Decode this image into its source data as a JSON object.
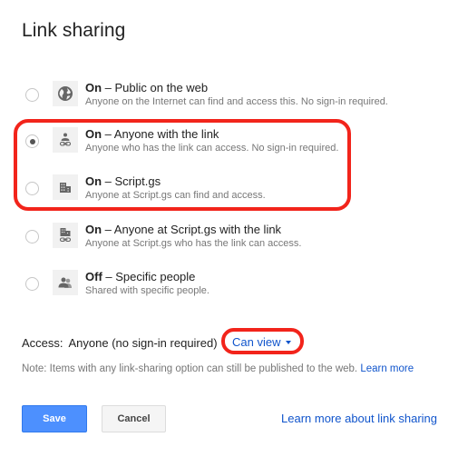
{
  "dialog": {
    "title": "Link sharing"
  },
  "options": [
    {
      "state": "On",
      "label": " – Public on the web",
      "description": "Anyone on the Internet can find and access this. No sign-in required.",
      "icon": "globe-icon",
      "selected": false
    },
    {
      "state": "On",
      "label": " – Anyone with the link",
      "description": "Anyone who has the link can access. No sign-in required.",
      "icon": "person-link-icon",
      "selected": true
    },
    {
      "state": "On",
      "label": " – Script.gs",
      "description": "Anyone at Script.gs can find and access.",
      "icon": "domain-icon",
      "selected": false
    },
    {
      "state": "On",
      "label": " – Anyone at Script.gs with the link",
      "description": "Anyone at Script.gs who has the link can access.",
      "icon": "domain-link-icon",
      "selected": false
    },
    {
      "state": "Off",
      "label": " – Specific people",
      "description": "Shared with specific people.",
      "icon": "people-icon",
      "selected": false
    }
  ],
  "access": {
    "label": "Access:",
    "value": "Anyone (no sign-in required)",
    "permission": "Can view"
  },
  "note": {
    "text": "Note: Items with any link-sharing option can still be published to the web. ",
    "link": "Learn more"
  },
  "buttons": {
    "save": "Save",
    "cancel": "Cancel"
  },
  "learn_more_sharing": "Learn more about link sharing",
  "colors": {
    "highlight": "#f2241b",
    "link": "#1155cc",
    "primary_button": "#4d90fe"
  }
}
